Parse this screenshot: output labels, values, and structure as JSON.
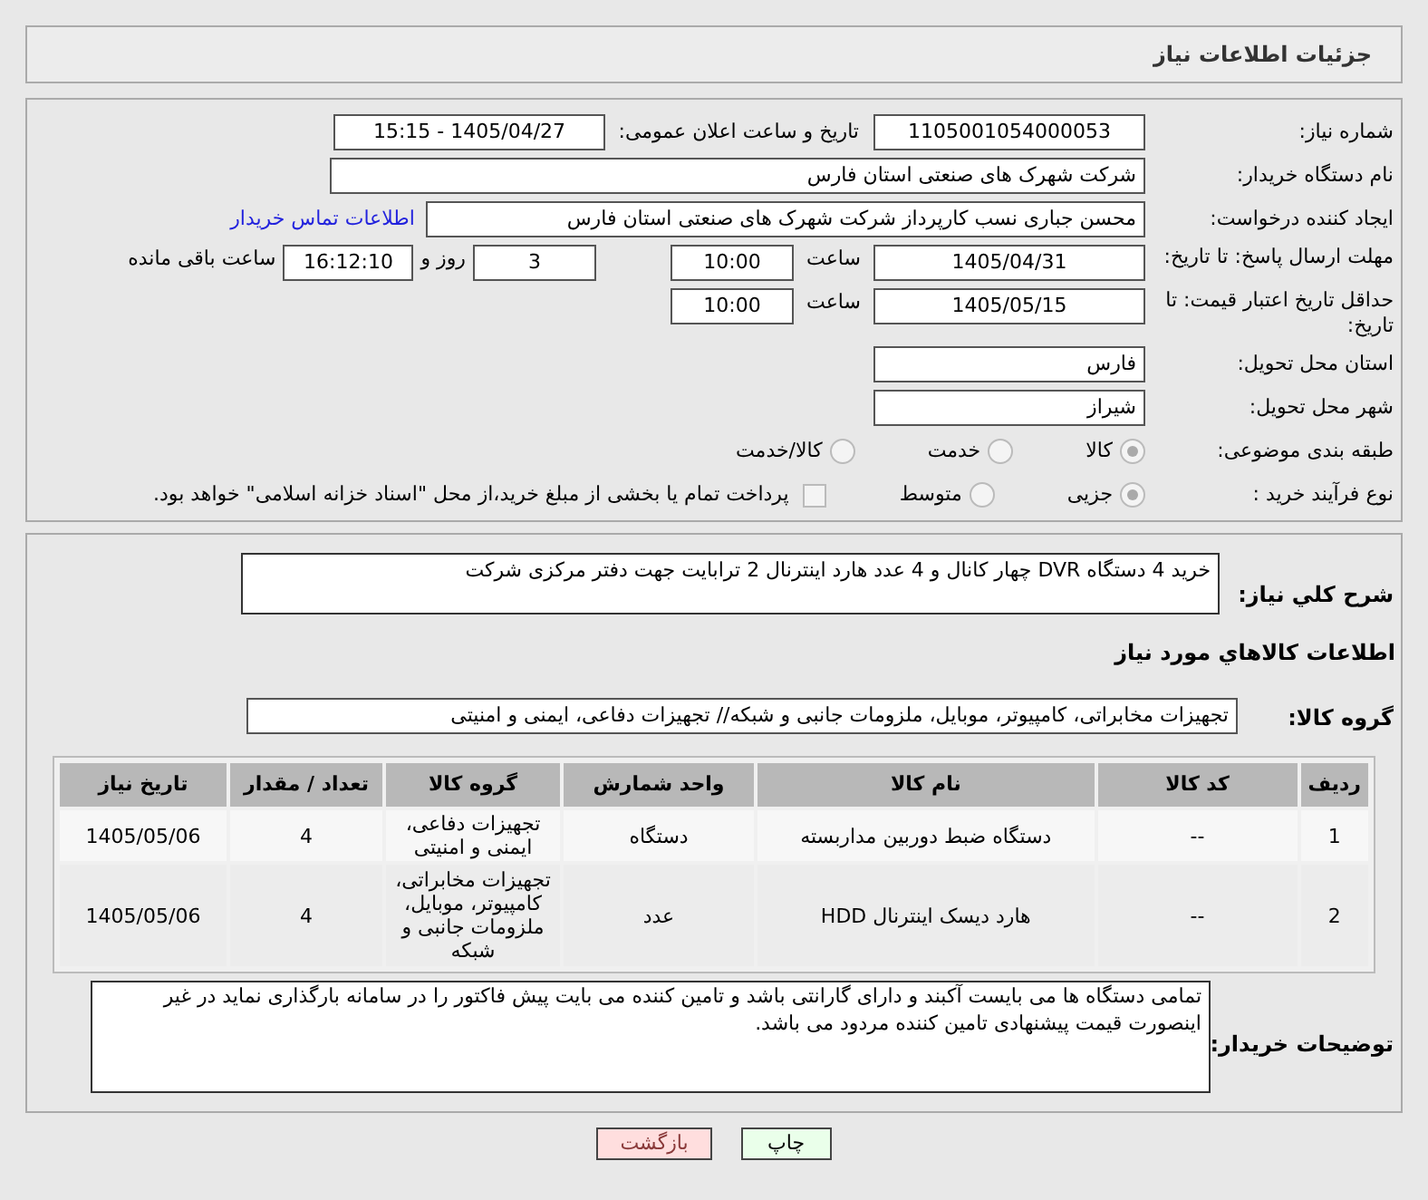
{
  "header": {
    "title": "جزئیات اطلاعات نیاز"
  },
  "need_number": {
    "label": "شماره نیاز:",
    "value": "1105001054000053"
  },
  "announce": {
    "label": "تاریخ و ساعت اعلان عمومی:",
    "value": "1405/04/27 - 15:15"
  },
  "buyer": {
    "label": "نام دستگاه خریدار:",
    "value": "شرکت شهرک های صنعتی استان فارس"
  },
  "creator": {
    "label": "ایجاد کننده درخواست:",
    "value": "محسن  جباری نسب کارپرداز شرکت شهرک های صنعتی استان فارس",
    "link": "اطلاعات تماس خریدار"
  },
  "deadline": {
    "label": "مهلت ارسال پاسخ: تا تاریخ:",
    "date": "1405/04/31",
    "time_label": "ساعت",
    "time": "10:00",
    "days": "3",
    "days_label": "روز و",
    "remaining": "16:12:10",
    "remaining_label": "ساعت باقی مانده"
  },
  "validity": {
    "label": "حداقل تاریخ اعتبار قیمت: تا تاریخ:",
    "date": "1405/05/15",
    "time_label": "ساعت",
    "time": "10:00"
  },
  "province": {
    "label": "استان محل تحویل:",
    "value": "فارس"
  },
  "city": {
    "label": "شهر محل تحویل:",
    "value": "شیراز"
  },
  "category": {
    "label": "طبقه بندی موضوعی:",
    "options": [
      {
        "label": "کالا",
        "selected": true
      },
      {
        "label": "خدمت",
        "selected": false
      },
      {
        "label": "کالا/خدمت",
        "selected": false
      }
    ]
  },
  "process": {
    "label": "نوع فرآیند خرید :",
    "options": [
      {
        "label": "جزیی",
        "selected": true
      },
      {
        "label": "متوسط",
        "selected": false
      }
    ],
    "payment": {
      "label": "پرداخت تمام یا بخشی از مبلغ خرید،از محل \"اسناد خزانه اسلامی\" خواهد بود.",
      "checked": false
    }
  },
  "description": {
    "label": "شرح کلي نياز:",
    "value": "خرید 4 دستگاه DVR  چهار کانال و 4 عدد هارد اینترنال 2 ترابایت جهت دفتر مرکزی شرکت"
  },
  "goods_title": "اطلاعات كالاهاي مورد نياز",
  "goods_group": {
    "label": "گروه کالا:",
    "value": "تجهیزات مخابراتی، کامپیوتر، موبایل، ملزومات جانبی و شبکه// تجهیزات دفاعی، ایمنی و امنیتی"
  },
  "table": {
    "columns": [
      "ردیف",
      "کد کالا",
      "نام کالا",
      "واحد شمارش",
      "گروه کالا",
      "تعداد / مقدار",
      "تاریخ نیاز"
    ],
    "rows": [
      [
        "1",
        "--",
        "دستگاه ضبط دوربین مداربسته",
        "دستگاه",
        "تجهیزات دفاعی، ایمنی و امنیتی",
        "4",
        "1405/05/06"
      ],
      [
        "2",
        "--",
        "هارد دیسک اینترنال HDD",
        "عدد",
        "تجهیزات مخابراتی، کامپیوتر، موبایل، ملزومات جانبی و شبکه",
        "4",
        "1405/05/06"
      ]
    ]
  },
  "notes": {
    "label": "توضیحات خریدار:",
    "value": "تمامی دستگاه ها می بایست آکبند و دارای گارانتی باشد و تامین کننده می بایت پیش فاکتور را در سامانه بارگذاری نماید در غیر اینصورت قیمت پیشنهادی تامین کننده مردود می باشد."
  },
  "buttons": [
    {
      "kind": "print",
      "label": "چاپ"
    },
    {
      "kind": "back",
      "label": "بازگشت"
    }
  ]
}
